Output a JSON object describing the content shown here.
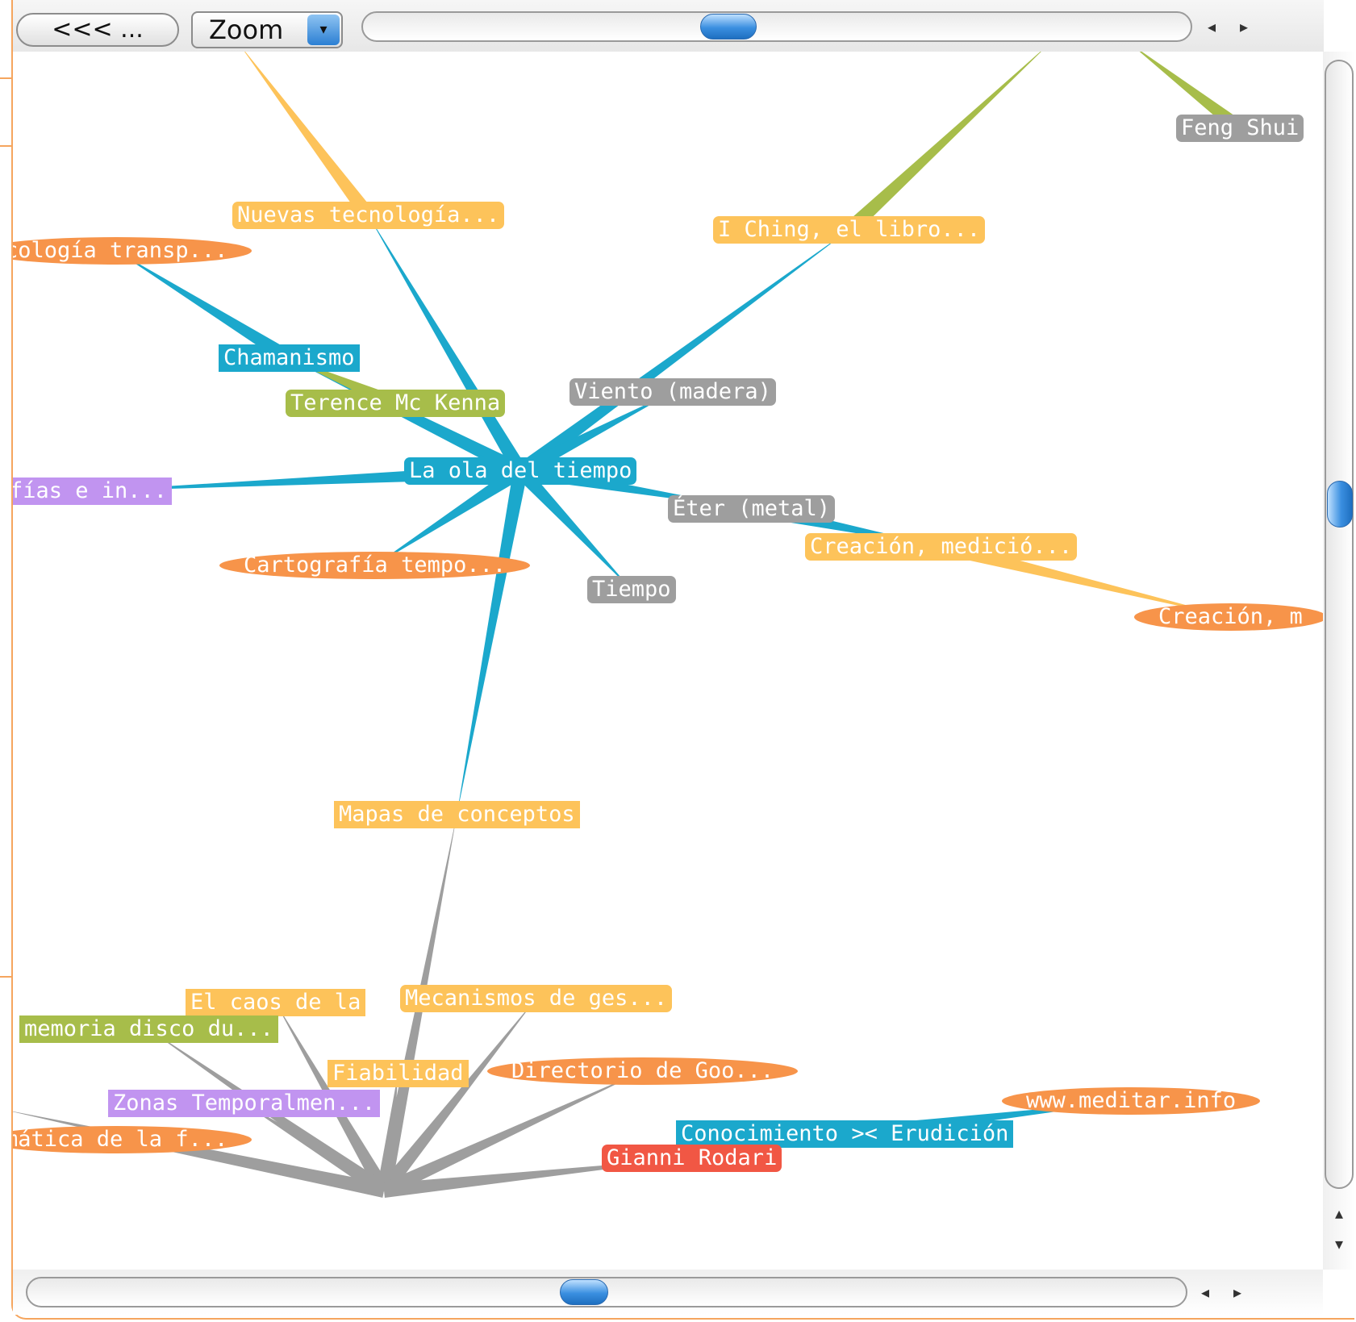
{
  "toolbar": {
    "back_label": "<<< ...",
    "zoom_label": "Zoom",
    "zoom_arrow": "▾",
    "scroll_left": "◂",
    "scroll_right": "▸"
  },
  "vscroll": {
    "up": "▴",
    "down": "▾"
  },
  "colors": {
    "blue": "#1ba8cc",
    "orange": "#f7944a",
    "yellow": "#fdc35a",
    "green": "#a7bd4a",
    "gray": "#9e9e9e",
    "purple": "#c194f0",
    "red": "#f15744",
    "frame": "#f5a55e"
  },
  "nodes": [
    {
      "id": "feng",
      "label": "Feng Shui",
      "color": "gray",
      "shape": "rounded"
    },
    {
      "id": "nuevas",
      "label": "Nuevas tecnología...",
      "color": "yellow",
      "shape": "rounded"
    },
    {
      "id": "iching",
      "label": "I Ching, el libro...",
      "color": "yellow",
      "shape": "rounded"
    },
    {
      "id": "psico",
      "label": "cología transp...",
      "color": "orange",
      "shape": "oval"
    },
    {
      "id": "chaman",
      "label": "Chamanismo",
      "color": "blue",
      "shape": "rect"
    },
    {
      "id": "terence",
      "label": "Terence Mc Kenna",
      "color": "green",
      "shape": "rounded"
    },
    {
      "id": "viento",
      "label": "Viento (madera)",
      "color": "gray",
      "shape": "rounded"
    },
    {
      "id": "ola",
      "label": "La ola del tiempo",
      "color": "blue",
      "shape": "rounded"
    },
    {
      "id": "fias",
      "label": "fías e in...",
      "color": "purple",
      "shape": "rect"
    },
    {
      "id": "eter",
      "label": "Éter (metal)",
      "color": "gray",
      "shape": "rounded"
    },
    {
      "id": "creacion1",
      "label": "Creación, medició...",
      "color": "yellow",
      "shape": "rounded"
    },
    {
      "id": "carto",
      "label": "Cartografía tempo...",
      "color": "orange",
      "shape": "oval"
    },
    {
      "id": "tiempo",
      "label": "Tiempo",
      "color": "gray",
      "shape": "rounded"
    },
    {
      "id": "creacion2",
      "label": "Creación, m",
      "color": "orange",
      "shape": "oval"
    },
    {
      "id": "mapas",
      "label": "Mapas de conceptos",
      "color": "yellow",
      "shape": "rect"
    },
    {
      "id": "caos",
      "label": "El caos de la",
      "color": "yellow",
      "shape": "rect"
    },
    {
      "id": "mecanismos",
      "label": "Mecanismos de ges...",
      "color": "yellow",
      "shape": "rounded"
    },
    {
      "id": "memoria",
      "label": "memoria  disco du...",
      "color": "green",
      "shape": "rect"
    },
    {
      "id": "fiab",
      "label": "Fiabilidad",
      "color": "yellow",
      "shape": "rect"
    },
    {
      "id": "directorio",
      "label": "Directorio de Goo...",
      "color": "orange",
      "shape": "oval"
    },
    {
      "id": "zonas",
      "label": "Zonas Temporalmen...",
      "color": "purple",
      "shape": "rect"
    },
    {
      "id": "meditar",
      "label": "www.meditar.info",
      "color": "orange",
      "shape": "oval"
    },
    {
      "id": "matica",
      "label": "mática de la f...",
      "color": "orange",
      "shape": "oval"
    },
    {
      "id": "conoc",
      "label": "Conocimiento >< Erudición",
      "color": "blue",
      "shape": "rect"
    },
    {
      "id": "gianni",
      "label": "Gianni Rodari",
      "color": "red",
      "shape": "rounded"
    }
  ],
  "links": [
    {
      "from": "ola",
      "to": "nuevas",
      "color": "blue"
    },
    {
      "from": "ola",
      "to": "iching",
      "color": "blue"
    },
    {
      "from": "ola",
      "to": "chaman",
      "color": "blue"
    },
    {
      "from": "ola",
      "to": "terence",
      "color": "blue"
    },
    {
      "from": "ola",
      "to": "viento",
      "color": "blue"
    },
    {
      "from": "ola",
      "to": "fias",
      "color": "blue"
    },
    {
      "from": "ola",
      "to": "eter",
      "color": "blue"
    },
    {
      "from": "ola",
      "to": "carto",
      "color": "blue"
    },
    {
      "from": "ola",
      "to": "tiempo",
      "color": "blue"
    },
    {
      "from": "ola",
      "to": "mapas",
      "color": "blue"
    },
    {
      "from": "chaman",
      "to": "psico",
      "color": "blue"
    },
    {
      "from": "terence",
      "to": "chaman",
      "color": "green"
    },
    {
      "from": "nuevas",
      "to": "offtop",
      "color": "yellow"
    },
    {
      "from": "iching",
      "to": "offright",
      "color": "green"
    },
    {
      "from": "feng",
      "to": "offtop2",
      "color": "green"
    },
    {
      "from": "eter",
      "to": "creacion1",
      "color": "blue"
    },
    {
      "from": "creacion1",
      "to": "creacion2",
      "color": "yellow"
    },
    {
      "from": "hub",
      "to": "mapas",
      "color": "gray"
    },
    {
      "from": "hub",
      "to": "caos",
      "color": "gray"
    },
    {
      "from": "hub",
      "to": "mecanismos",
      "color": "gray"
    },
    {
      "from": "hub",
      "to": "memoria",
      "color": "gray"
    },
    {
      "from": "hub",
      "to": "fiab",
      "color": "gray"
    },
    {
      "from": "hub",
      "to": "directorio",
      "color": "gray"
    },
    {
      "from": "hub",
      "to": "zonas",
      "color": "gray"
    },
    {
      "from": "hub",
      "to": "matica",
      "color": "gray"
    },
    {
      "from": "hub",
      "to": "gianni",
      "color": "gray"
    },
    {
      "from": "hub",
      "to": "offleft",
      "color": "gray"
    },
    {
      "from": "conoc",
      "to": "meditar",
      "color": "blue"
    }
  ]
}
